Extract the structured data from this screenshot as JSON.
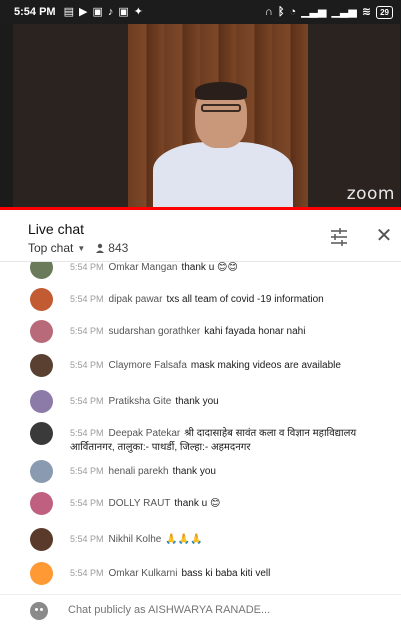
{
  "status_bar": {
    "time": "5:54 PM",
    "battery": "29"
  },
  "video": {
    "watermark": "zoom",
    "accent_color": "#ff0000"
  },
  "chat_header": {
    "title": "Live chat",
    "mode": "Top chat",
    "viewer_count": "843"
  },
  "messages": [
    {
      "time": "5:54 PM",
      "author": "Omkar Mangan",
      "text": "thank u 😊😊",
      "avatar_color": "#6b7a5a"
    },
    {
      "time": "5:54 PM",
      "author": "dipak pawar",
      "text": "txs all team of covid -19 information",
      "avatar_color": "#c25a32"
    },
    {
      "time": "5:54 PM",
      "author": "sudarshan gorathker",
      "text": "kahi fayada honar nahi",
      "avatar_color": "#b86a7a"
    },
    {
      "time": "5:54 PM",
      "author": "Claymore Falsafa",
      "text": "mask making videos are available",
      "avatar_color": "#5a4030"
    },
    {
      "time": "5:54 PM",
      "author": "Pratiksha Gite",
      "text": "thank you",
      "avatar_color": "#8c7aa8"
    },
    {
      "time": "5:54 PM",
      "author": "Deepak Patekar",
      "text": "श्री दादासाहेब सावंत कला व विज्ञान महाविद्यालय आर्वितानगर, तालुका:- पाथर्डी, जिल्हा:- अहमदनगर",
      "avatar_color": "#3a3a3a"
    },
    {
      "time": "5:54 PM",
      "author": "henali parekh",
      "text": "thank you",
      "avatar_color": "#8a9ab0"
    },
    {
      "time": "5:54 PM",
      "author": "DOLLY RAUT",
      "text": "thank u 😊",
      "avatar_color": "#c06080"
    },
    {
      "time": "5:54 PM",
      "author": "Nikhil Kolhe",
      "text": "🙏🙏🙏",
      "avatar_color": "#5a3a2a"
    },
    {
      "time": "5:54 PM",
      "author": "Omkar Kulkarni",
      "text": "bass ki baba kiti vell",
      "avatar_color": "#ff9933"
    }
  ],
  "input": {
    "placeholder": "Chat publicly as AISHWARYA RANADE..."
  }
}
